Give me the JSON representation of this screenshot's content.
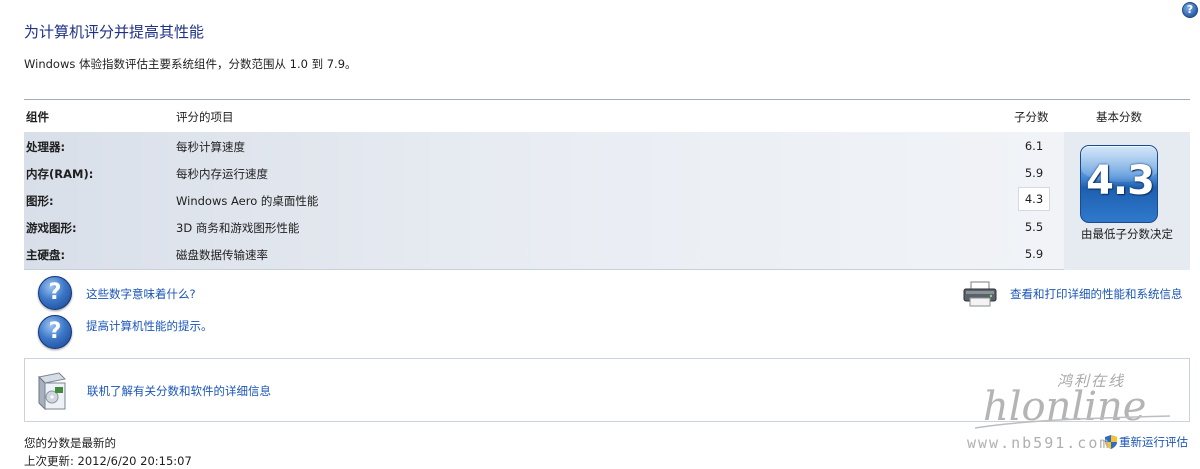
{
  "page": {
    "title": "为计算机评分并提高其性能",
    "subtitle": "Windows 体验指数评估主要系统组件，分数范围从 1.0 到 7.9。",
    "help_icon": "?"
  },
  "table": {
    "headers": {
      "component": "组件",
      "rated_item": "评分的项目",
      "subscore": "子分数",
      "base_score": "基本分数"
    },
    "rows": [
      {
        "component": "处理器:",
        "item": "每秒计算速度",
        "subscore": "6.1"
      },
      {
        "component": "内存(RAM):",
        "item": "每秒内存运行速度",
        "subscore": "5.9"
      },
      {
        "component": "图形:",
        "item": "Windows Aero 的桌面性能",
        "subscore": "4.3"
      },
      {
        "component": "游戏图形:",
        "item": "3D 商务和游戏图形性能",
        "subscore": "5.5"
      },
      {
        "component": "主硬盘:",
        "item": "磁盘数据传输速率",
        "subscore": "5.9"
      }
    ],
    "base_score": {
      "value": "4.3",
      "caption": "由最低子分数决定"
    }
  },
  "links": {
    "what_numbers_mean": "这些数字意味着什么?",
    "tips": "提高计算机性能的提示。",
    "view_print": "查看和打印详细的性能和系统信息",
    "online_info": "联机了解有关分数和软件的详细信息"
  },
  "icons": {
    "help": "help-icon",
    "printer": "printer-icon",
    "software_box": "software-box-icon",
    "uac_shield": "uac-shield-icon"
  },
  "status": {
    "current": "您的分数是最新的",
    "last_update": "上次更新: 2012/6/20 20:15:07",
    "rerun": "重新运行评估"
  },
  "watermark": {
    "brand": "hlonline",
    "chinese": "鸿利在线",
    "url": "www.nb591.com"
  },
  "colors": {
    "title": "#1e3287",
    "link": "#1a55b8",
    "badge": "#2f79cc"
  }
}
